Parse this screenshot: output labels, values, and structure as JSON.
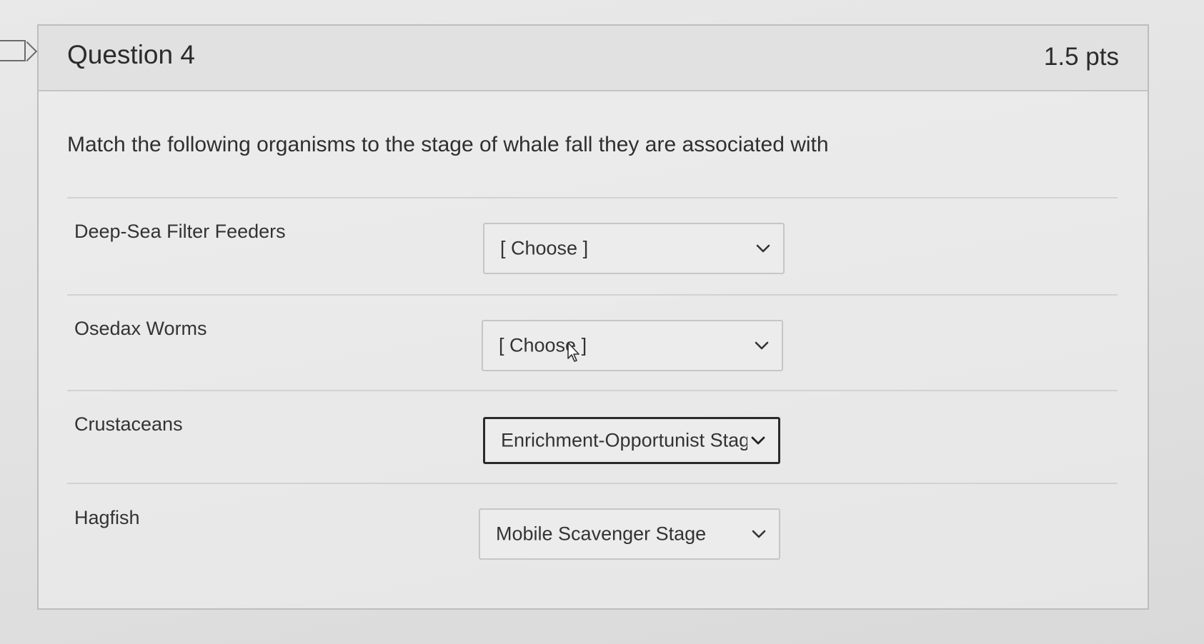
{
  "question": {
    "title": "Question 4",
    "points": "1.5 pts",
    "text": "Match the following organisms to the stage of whale fall they are associated with"
  },
  "answers": [
    {
      "label": "Deep-Sea Filter Feeders",
      "selected": "[ Choose ]"
    },
    {
      "label": "Osedax Worms",
      "selected": "[ Choose ]"
    },
    {
      "label": "Crustaceans",
      "selected": "Enrichment-Opportunist Stag"
    },
    {
      "label": "Hagfish",
      "selected": "Mobile Scavenger Stage"
    }
  ],
  "icons": {
    "flag": "flag-icon",
    "dropdown": "chevron-down-icon",
    "cursor": "mouse-pointer-icon"
  }
}
